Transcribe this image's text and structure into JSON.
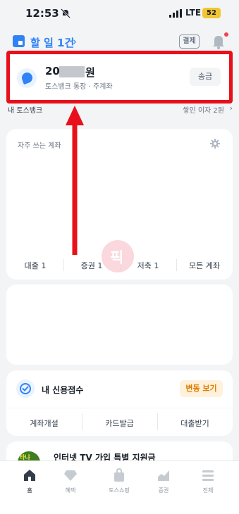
{
  "status_bar": {
    "time": "12:53",
    "network": "LTE",
    "battery": "52"
  },
  "header": {
    "todo": "할 일 1건",
    "chevron": "›",
    "pay_button": "결제"
  },
  "account": {
    "amount_prefix": "20",
    "currency": "원",
    "subtitle": "토스뱅크 통장 · 주계좌",
    "send_button": "송금"
  },
  "toss_bank": {
    "label": "내 토스뱅크",
    "interest": "쌓인 이자 2원",
    "chevron": "›"
  },
  "frequent": {
    "title": "자주 쓰는 계좌",
    "tabs": [
      {
        "label": "대출 1"
      },
      {
        "label": "증권 1"
      },
      {
        "label": "저축 1"
      },
      {
        "label": "모든 계좌"
      }
    ]
  },
  "credit": {
    "title": "내 신용점수",
    "change_button": "변동 보기",
    "actions": [
      {
        "label": "계좌개설"
      },
      {
        "label": "카드발급"
      },
      {
        "label": "대출받기"
      }
    ]
  },
  "promo": {
    "title": "인터넷 TV 가입 특별 지원금"
  },
  "bottom_nav": [
    {
      "label": "홈",
      "icon": "home-icon"
    },
    {
      "label": "혜택",
      "icon": "gem-icon"
    },
    {
      "label": "토스쇼핑",
      "icon": "shopping-bag-icon"
    },
    {
      "label": "증권",
      "icon": "chart-icon"
    },
    {
      "label": "전체",
      "icon": "menu-icon"
    }
  ],
  "colors": {
    "accent": "#3182f6",
    "highlight_frame": "#e8101a",
    "badge": "#f2c531",
    "warning": "#e07b00"
  }
}
